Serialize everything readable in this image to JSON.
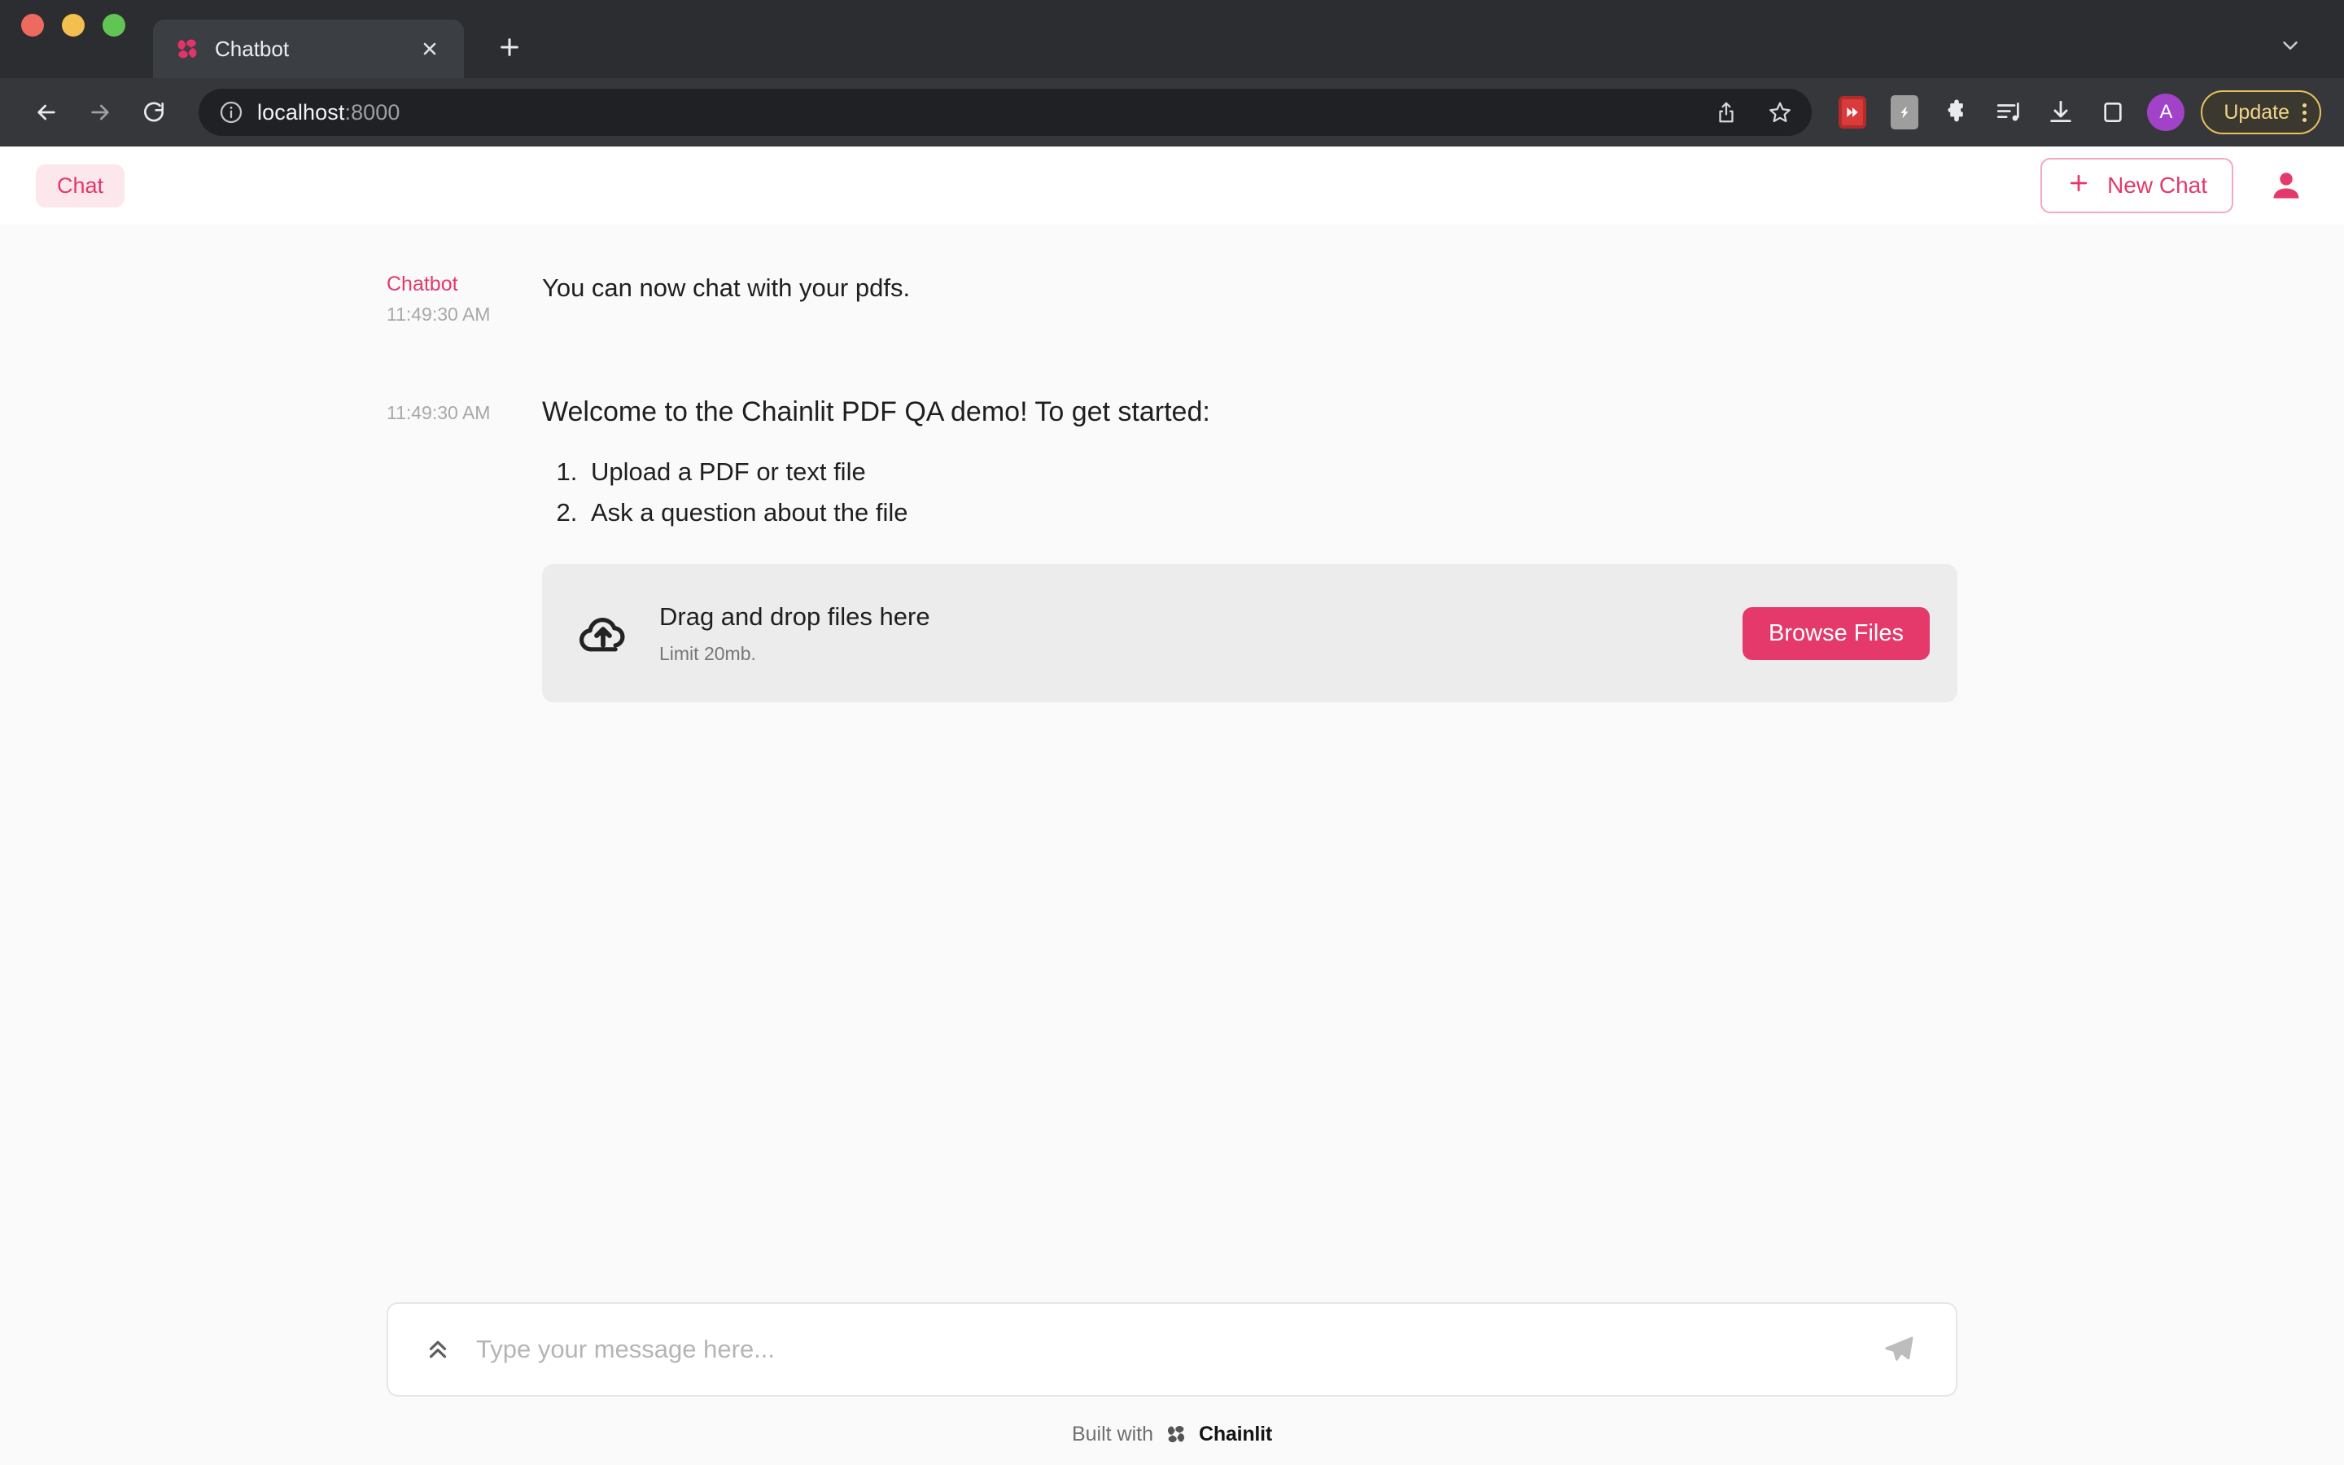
{
  "browser": {
    "window_controls": [
      "close",
      "minimize",
      "maximize"
    ],
    "tab": {
      "title": "Chatbot",
      "favicon": "chainlit-logo-icon",
      "close_label": "×"
    },
    "new_tab_label": "+",
    "tabstrip_menu_icon": "chevron-down-icon",
    "nav": {
      "back_icon": "arrow-left-icon",
      "forward_icon": "arrow-right-icon",
      "reload_icon": "reload-icon"
    },
    "omnibox": {
      "info_icon": "info-circle-icon",
      "url_host": "localhost",
      "url_port": ":8000",
      "share_icon": "share-icon",
      "bookmark_icon": "star-icon"
    },
    "extensions": [
      {
        "name": "video-downloader-extension-icon",
        "label": "»"
      },
      {
        "name": "grammar-extension-icon",
        "label": ""
      },
      {
        "name": "puzzle-extension-icon",
        "label": ""
      },
      {
        "name": "reading-list-icon",
        "label": ""
      },
      {
        "name": "downloads-icon",
        "label": ""
      },
      {
        "name": "side-panel-icon",
        "label": ""
      }
    ],
    "profile_avatar_letter": "A",
    "update_button_label": "Update",
    "menu_icon": "kebab-menu-icon"
  },
  "app": {
    "header": {
      "chat_tab_label": "Chat",
      "new_chat_label": "New Chat",
      "new_chat_icon": "plus-icon",
      "user_icon": "user-avatar-icon"
    },
    "messages": [
      {
        "author": "Chatbot",
        "time": "11:49:30 AM",
        "text": "You can now chat with your pdfs.",
        "size": "normal"
      },
      {
        "author": "",
        "time": "11:49:30 AM",
        "text": "Welcome to the Chainlit PDF QA demo! To get started:",
        "size": "large",
        "list": [
          "Upload a PDF or text file",
          "Ask a question about the file"
        ]
      }
    ],
    "dropzone": {
      "icon": "cloud-upload-icon",
      "title": "Drag and drop files here",
      "subtitle": "Limit 20mb.",
      "browse_label": "Browse Files"
    },
    "composer": {
      "expand_icon": "double-chevron-up-icon",
      "placeholder": "Type your message here...",
      "value": "",
      "send_icon": "send-paper-plane-icon"
    },
    "footer": {
      "prefix": "Built with",
      "brand": "Chainlit",
      "logo_icon": "chainlit-logo-icon"
    }
  },
  "colors": {
    "accent": "#e4396a",
    "accent_soft": "#fce7ec",
    "browser_chrome": "#2b2d30",
    "toolbar": "#35373b",
    "omnibox": "#202124",
    "app_bg": "#fafafa",
    "dropzone_bg": "#ececec",
    "update_border": "#e8c35c"
  }
}
